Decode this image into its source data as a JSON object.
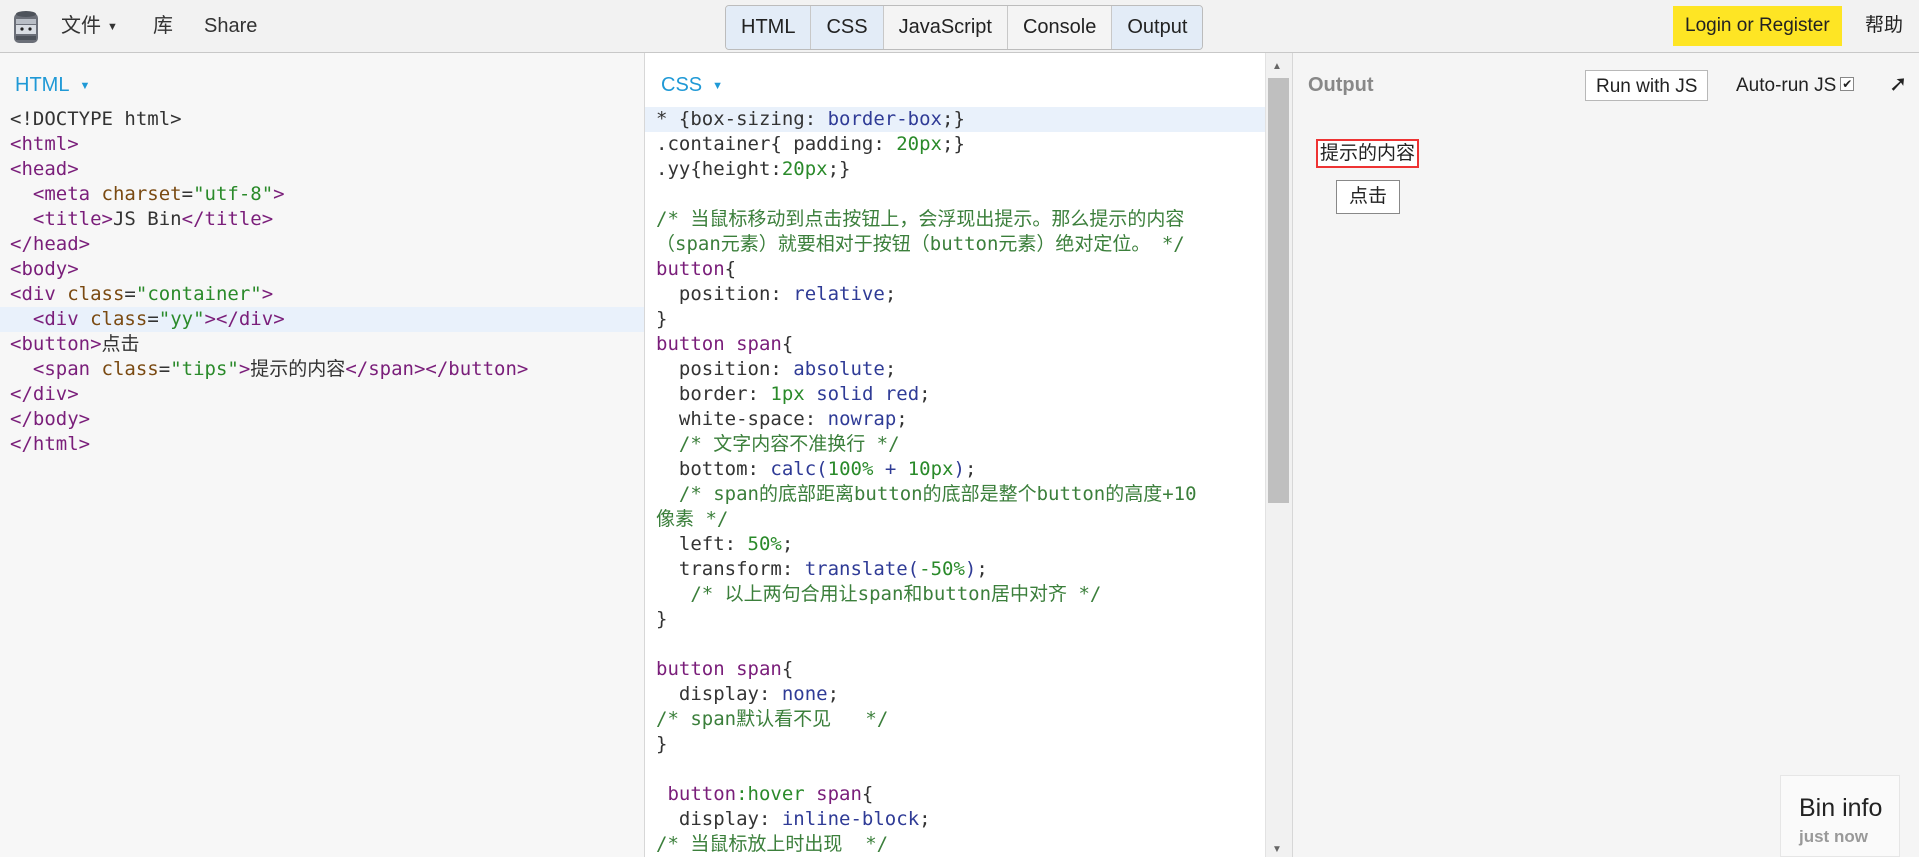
{
  "menu": {
    "file": "文件",
    "library": "库",
    "share": "Share",
    "login": "Login or Register",
    "help": "帮助"
  },
  "panel_tabs": [
    {
      "label": "HTML",
      "active": true
    },
    {
      "label": "CSS",
      "active": true
    },
    {
      "label": "JavaScript",
      "active": false
    },
    {
      "label": "Console",
      "active": false
    },
    {
      "label": "Output",
      "active": true
    }
  ],
  "html_panel": {
    "label": "HTML",
    "lines": [
      "<!DOCTYPE html>",
      "<html>",
      "<head>",
      "  <meta charset=\"utf-8\">",
      "  <title>JS Bin</title>",
      "</head>",
      "<body>",
      "<div class=\"container\">",
      "  <div class=\"yy\"></div>",
      "<button>点击",
      "  <span class=\"tips\">提示的内容</span></button>",
      "</div>",
      "</body>",
      "</html>"
    ]
  },
  "css_panel": {
    "label": "CSS",
    "lines": [
      "* {box-sizing: border-box;}",
      ".container{ padding: 20px;}",
      ".yy{height:20px;}",
      "",
      "/* 当鼠标移动到点击按钮上，会浮现出提示。那么提示的内容",
      "（span元素）就要相对于按钮（button元素）绝对定位。 */",
      "button{",
      "  position: relative;",
      "}",
      "button span{",
      "  position: absolute;",
      "  border: 1px solid red;",
      "  white-space: nowrap;",
      "  /* 文字内容不准换行 */",
      "  bottom: calc(100% + 10px);",
      "  /* span的底部距离button的底部是整个button的高度+10",
      "像素 */",
      "  left: 50%;",
      "  transform: translate(-50%);",
      "   /* 以上两句合用让span和button居中对齐 */",
      "}",
      "",
      "button span{",
      "  display:none;",
      "/* span默认看不见   */",
      "}",
      "",
      " button:hover span{",
      "  display: inline-block;",
      "/* 当鼠标放上时出现  */"
    ]
  },
  "output_panel": {
    "label": "Output",
    "run_button": "Run with JS",
    "autorun_label": "Auto-run JS",
    "autorun_checked": true,
    "popout_icon": "popout-arrow-icon",
    "demo_tips": "提示的内容",
    "demo_button": "点击",
    "bin_info_title": "Bin info",
    "bin_info_sub": "just now"
  },
  "colors": {
    "accent_blue": "#1f99d6",
    "login_yellow": "#fee524",
    "tips_border": "#ee3333"
  }
}
